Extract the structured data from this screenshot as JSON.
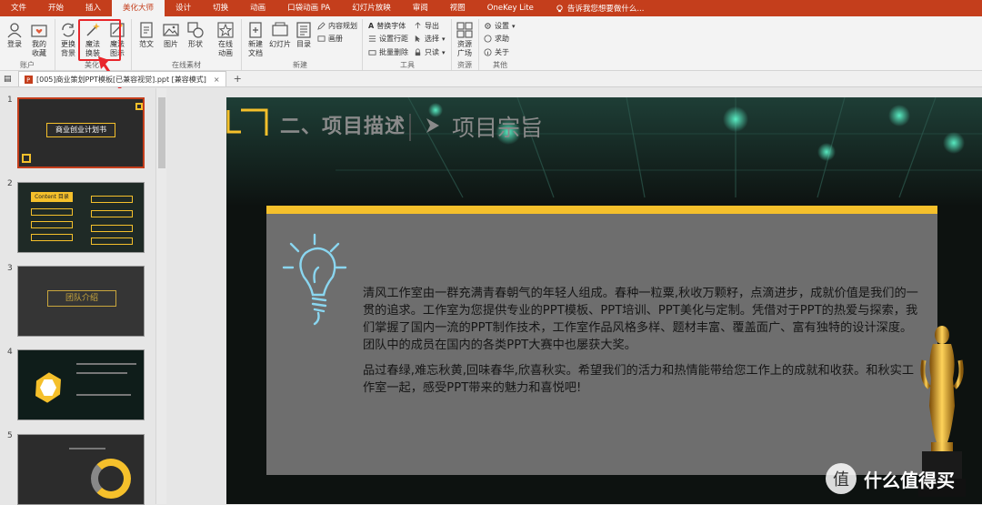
{
  "menubar": {
    "tabs": [
      "文件",
      "开始",
      "插入",
      "美化大师",
      "设计",
      "切换",
      "动画",
      "口袋动画 PA",
      "幻灯片放映",
      "审阅",
      "视图",
      "OneKey Lite"
    ],
    "active_tab": "美化大师",
    "tell_me": "告诉我您想要做什么..."
  },
  "ribbon": {
    "login": "登录",
    "my_fav": "我的\n收藏",
    "change_bg": "更换\n背景",
    "magic_swap": "魔法\n换装",
    "magic_chart": "魔法\n图示",
    "fanwen": "范文",
    "picture": "图片",
    "shape": "形状",
    "online_anim": "在线\n动画",
    "new_doc": "新建\n文档",
    "slides": "幻灯片",
    "toc": "目录",
    "content_plan": "内容规划",
    "album": "画册",
    "replace_font": "替换字体",
    "set_spacing": "设置行距",
    "batch_delete": "批量删除",
    "export": "导出",
    "select": "选择",
    "keep_only": "只读",
    "resource_plaza": "资源\n广场",
    "settings": "设置",
    "help": "求助",
    "about": "关于",
    "groups": {
      "account": "账户",
      "beautify": "美化",
      "online_material": "在线素材",
      "new": "新建",
      "tools": "工具",
      "resources": "资源",
      "other": "其他"
    }
  },
  "document_tab": {
    "title": "[005]商业策划PPT模板[已兼容视觉].ppt [兼容模式]",
    "close": "×",
    "add": "+"
  },
  "thumbnails": [
    {
      "num": "1",
      "label": "商业创业计划书"
    },
    {
      "num": "2",
      "label": "Content 目录"
    },
    {
      "num": "3",
      "label": "团队介绍"
    },
    {
      "num": "4",
      "label": ""
    },
    {
      "num": "5",
      "label": ""
    }
  ],
  "slide": {
    "title": "二、项目描述",
    "subtitle": "项目宗旨",
    "paragraph1": "清风工作室由一群充满青春朝气的年轻人组成。春种一粒粟,秋收万颗籽，点滴进步，成就价值是我们的一贯的追求。工作室为您提供专业的PPT模板、PPT培训、PPT美化与定制。凭借对于PPT的热爱与探索，我们掌握了国内一流的PPT制作技术，工作室作品风格多样、题材丰富、覆盖面广、富有独特的设计深度。团队中的成员在国内的各类PPT大赛中也屡获大奖。",
    "paragraph2": "品过春绿,难忘秋黄,回味春华,欣喜秋实。希望我们的活力和热情能带给您工作上的成就和收获。和秋实工作室一起，感受PPT带来的魅力和喜悦吧!"
  },
  "watermark": "什么值得买",
  "colors": {
    "accent": "#c43e1c",
    "highlight": "#e8262b",
    "slide_yellow": "#f5c02b"
  }
}
